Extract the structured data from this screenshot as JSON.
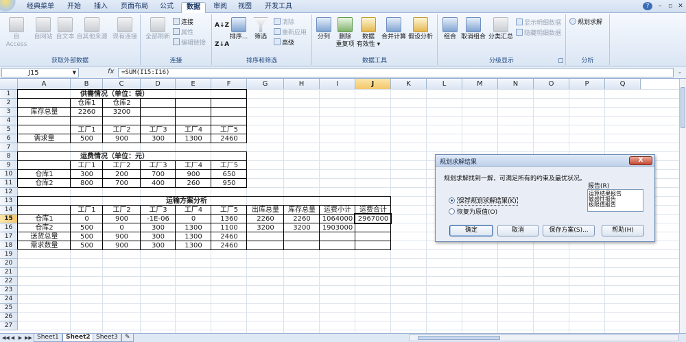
{
  "ribbon_tabs": [
    "经典菜单",
    "开始",
    "插入",
    "页面布局",
    "公式",
    "数据",
    "审阅",
    "视图",
    "开发工具"
  ],
  "active_tab": "数据",
  "window_buttons": {
    "help": "?",
    "minimize": "–",
    "restore": "▫",
    "close": "✕"
  },
  "groups": {
    "external_data": {
      "title": "获取外部数据",
      "buttons": [
        "自 Access",
        "自网站",
        "自文本",
        "自其他来源",
        "现有连接"
      ]
    },
    "connections": {
      "title": "连接",
      "refresh_all": "全部刷新",
      "connections": "连接",
      "properties": "属性",
      "edit_links": "编辑链接"
    },
    "sort_filter": {
      "title": "排序和筛选",
      "sort": "排序...",
      "filter": "筛选",
      "clear": "清除",
      "reapply": "重新应用",
      "advanced": "高级"
    },
    "data_tools": {
      "title": "数据工具",
      "text_to_columns": "分列",
      "remove_duplicates_1": "删除",
      "remove_duplicates_2": "重复项",
      "validation_1": "数据",
      "validation_2": "有效性 ▾",
      "consolidate": "合并计算",
      "what_if": "假设分析"
    },
    "outline": {
      "title": "分级显示",
      "group": "组合",
      "ungroup": "取消组合",
      "subtotal": "分类汇总",
      "show_detail": "显示明细数据",
      "hide_detail": "隐藏明细数据"
    },
    "analysis": {
      "title": "分析",
      "solver": "规划求解"
    }
  },
  "formula_bar": {
    "name_box": "J15",
    "fx": "fx",
    "formula": "=SUM(I15:I16)"
  },
  "columns": [
    "A",
    "B",
    "C",
    "D",
    "E",
    "F",
    "G",
    "H",
    "I",
    "J",
    "K",
    "L",
    "M",
    "N",
    "O",
    "P",
    "Q"
  ],
  "selected_column": "J",
  "rows": [
    "1",
    "2",
    "3",
    "4",
    "5",
    "6",
    "7",
    "8",
    "9",
    "10",
    "11",
    "12",
    "13",
    "14",
    "15",
    "16",
    "17",
    "18",
    "19",
    "20",
    "21",
    "22",
    "23",
    "24",
    "25",
    "26",
    "27"
  ],
  "selected_row": "15",
  "table_supply": {
    "title": "供需情况（单位：袋）",
    "warehouse1": "仓库1",
    "warehouse2": "仓库2",
    "stock_label": "库存总量",
    "stock1": "2260",
    "stock2": "3200",
    "factories": [
      "工厂1",
      "工厂2",
      "工厂3",
      "工厂4",
      "工厂5"
    ],
    "demand_label": "需求量",
    "demand": [
      "500",
      "900",
      "300",
      "1300",
      "2460"
    ]
  },
  "table_cost": {
    "title": "运费情况（单位：元）",
    "factories": [
      "工厂1",
      "工厂2",
      "工厂3",
      "工厂4",
      "工厂5"
    ],
    "row1_label": "仓库1",
    "row1": [
      "300",
      "200",
      "700",
      "900",
      "650"
    ],
    "row2_label": "仓库2",
    "row2": [
      "800",
      "700",
      "400",
      "260",
      "950"
    ]
  },
  "table_plan": {
    "title": "运输方案分析",
    "headers": [
      "工厂1",
      "工厂2",
      "工厂3",
      "工厂4",
      "工厂5",
      "出库总量",
      "库存总量",
      "运费小计",
      "运费合计"
    ],
    "row15_label": "仓库1",
    "row15": [
      "0",
      "900",
      "-1E-06",
      "0",
      "1360",
      "2260",
      "2260",
      "1064000",
      "2967000"
    ],
    "row16_label": "仓库2",
    "row16": [
      "500",
      "0",
      "300",
      "1300",
      "1100",
      "3200",
      "3200",
      "1903000"
    ],
    "row17_label": "送货总量",
    "row17": [
      "500",
      "900",
      "300",
      "1300",
      "2460"
    ],
    "row18_label": "需求数量",
    "row18": [
      "500",
      "900",
      "300",
      "1300",
      "2460"
    ]
  },
  "sheets": [
    "Sheet1",
    "Sheet2",
    "Sheet3"
  ],
  "active_sheet": "Sheet2",
  "dialog": {
    "title": "规划求解结果",
    "close": "X",
    "message": "规划求解找到一解，可满足所有的约束及最优状况。",
    "report_label": "报告(R)",
    "reports": [
      "运算结果报告",
      "敏感性报告",
      "极限值报告"
    ],
    "option_keep": "保存规划求解结果(K)",
    "option_restore": "恢复为原值(O)",
    "ok": "确定",
    "cancel": "取消",
    "save_scenario": "保存方案(S)...",
    "help": "帮助(H)"
  }
}
